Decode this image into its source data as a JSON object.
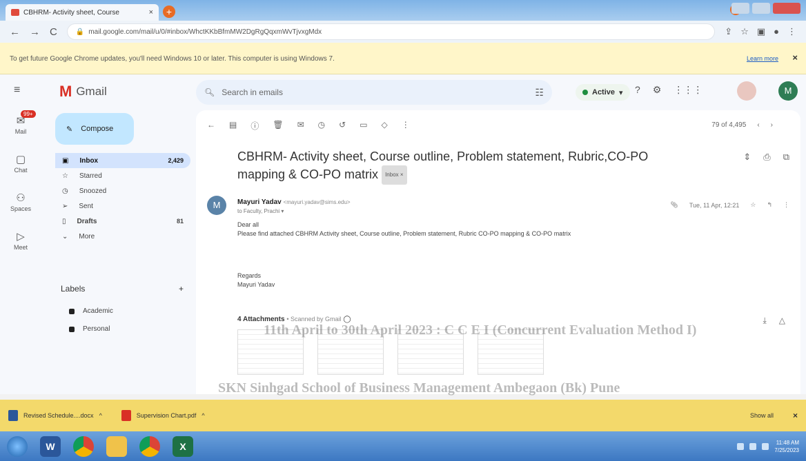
{
  "browser": {
    "tab_title": "CBHRM- Activity sheet, Course",
    "tab_close": "×",
    "new_tab": "+",
    "url": "mail.google.com/mail/u/0/#inbox/WhctKKbBfmMW2DgRgQqxmWvTjvxgMdx",
    "info_bar_text": "To get future Google Chrome updates, you'll need Windows 10 or later. This computer is using Windows 7.",
    "info_bar_link": "Learn more",
    "info_bar_close": "×"
  },
  "gmail": {
    "app_name": "Gmail",
    "search_placeholder": "Search in emails",
    "status": "Active",
    "avatar_letter": "M",
    "compose_label": "Compose",
    "rail": [
      {
        "label": "Mail",
        "badge": "99+"
      },
      {
        "label": "Chat"
      },
      {
        "label": "Spaces"
      },
      {
        "label": "Meet"
      }
    ],
    "folders": [
      {
        "label": "Inbox",
        "count": "2,429"
      },
      {
        "label": "Starred",
        "count": ""
      },
      {
        "label": "Snoozed",
        "count": ""
      },
      {
        "label": "Sent",
        "count": ""
      },
      {
        "label": "Drafts",
        "count": "81"
      },
      {
        "label": "More",
        "count": ""
      }
    ],
    "labels_title": "Labels",
    "labels_add": "+",
    "labels": [
      "Academic",
      "Personal"
    ]
  },
  "message": {
    "pager_text": "79 of 4,495",
    "subject": "CBHRM- Activity sheet, Course outline, Problem statement, Rubric,CO-PO mapping & CO-PO matrix",
    "chip": "Inbox ×",
    "sender_initial": "M",
    "sender_name": "Mayuri Yadav",
    "sender_email": "<mayuri.yadav@sims.edu>",
    "to_line": "to Faculty, Prachi ▾",
    "date": "Tue, 11 Apr, 12:21",
    "greeting": "Dear all",
    "body": "Please find attached CBHRM Activity sheet, Course outline, Problem statement, Rubric CO-PO mapping & CO-PO matrix",
    "regards": "Regards",
    "signature": "Mayuri Yadav",
    "attachments_count": "4 Attachments",
    "scanned": "• Scanned by Gmail"
  },
  "ghost_text": {
    "line1": "11th April to 30th April 2023 : C C E I (Concurrent Evaluation Method I)",
    "line2": "SKN Sinhgad School of Business Management Ambegaon (Bk) Pune"
  },
  "downloads": {
    "items": [
      "Revised Schedule....docx",
      "Supervision Chart.pdf"
    ],
    "show_all": "Show all",
    "close": "×"
  },
  "taskbar": {
    "time": "11:48 AM",
    "date": "7/25/2023"
  }
}
